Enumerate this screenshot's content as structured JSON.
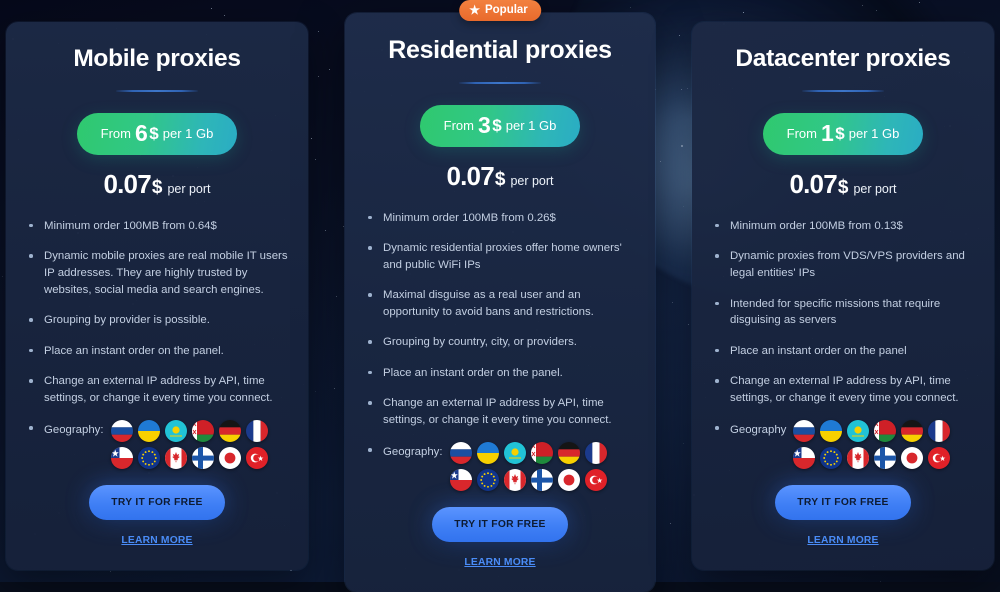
{
  "theme": {
    "background_color": "#080e1c",
    "card_color": "#1c2945",
    "accent_green_start": "#2fc96e",
    "accent_teal_end": "#2aacc4",
    "accent_blue": "#3f7ff5",
    "badge_orange": "#e96a2c",
    "divider_blue": "#3d76c9",
    "body_text_color": "#c3cfe2"
  },
  "badge": {
    "label": "Popular",
    "icon": "star-icon"
  },
  "flag_set": [
    "Russia",
    "Ukraine",
    "Kazakhstan",
    "Belarus",
    "Germany",
    "France",
    "Chile",
    "European Union",
    "Canada",
    "Finland",
    "Japan",
    "Turkey"
  ],
  "cards": [
    {
      "id": "mobile-proxies",
      "title": "Mobile proxies",
      "featured": false,
      "price": {
        "from_label": "From",
        "amount": "6",
        "currency": "$",
        "unit": "per 1 Gb"
      },
      "per_port": {
        "amount": "0.07",
        "currency": "$",
        "label": "per port"
      },
      "features": [
        "Minimum order 100MB from 0.64$",
        "Dynamic mobile proxies are real mobile IT users IP addresses. They are highly trusted by websites, social media and search engines.",
        "Grouping by provider is possible.",
        "Place an instant order on the panel.",
        "Change an external IP address by API, time settings, or change it every time you connect."
      ],
      "geography_label": "Geography:",
      "cta_label": "TRY IT FOR FREE",
      "learn_more_label": "LEARN MORE"
    },
    {
      "id": "residential-proxies",
      "title": "Residential proxies",
      "featured": true,
      "price": {
        "from_label": "From",
        "amount": "3",
        "currency": "$",
        "unit": "per 1 Gb"
      },
      "per_port": {
        "amount": "0.07",
        "currency": "$",
        "label": "per port"
      },
      "features": [
        "Minimum order 100MB from 0.26$",
        "Dynamic residential proxies offer home owners' and public WiFi IPs",
        "Maximal disguise as a real user and an opportunity to avoid bans and restrictions.",
        "Grouping by country, city, or providers.",
        "Place an instant order on the panel.",
        "Change an external IP address by API, time settings, or change it every time you connect."
      ],
      "geography_label": "Geography:",
      "cta_label": "TRY IT FOR FREE",
      "learn_more_label": "LEARN MORE"
    },
    {
      "id": "datacenter-proxies",
      "title": "Datacenter proxies",
      "featured": false,
      "price": {
        "from_label": "From",
        "amount": "1",
        "currency": "$",
        "unit": "per 1 Gb"
      },
      "per_port": {
        "amount": "0.07",
        "currency": "$",
        "label": "per port"
      },
      "features": [
        "Minimum order 100MB from 0.13$",
        "Dynamic proxies from VDS/VPS providers and legal entities' IPs",
        "Intended for specific missions that require disguising as servers",
        "Place an instant order on the panel",
        "Change an external IP address by API, time settings, or change it every time you connect."
      ],
      "geography_label": "Geography",
      "cta_label": "TRY IT FOR FREE",
      "learn_more_label": "LEARN MORE"
    }
  ]
}
